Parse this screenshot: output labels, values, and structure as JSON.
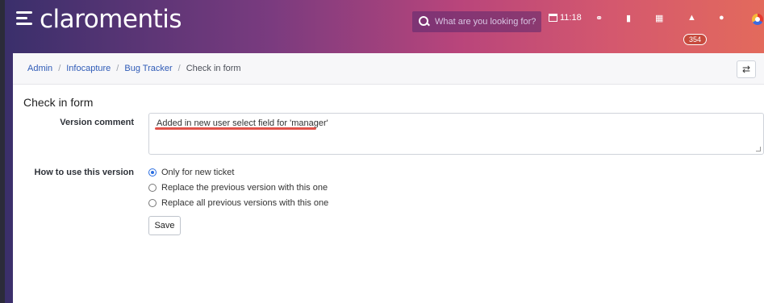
{
  "app": {
    "logo_text": "claromentis"
  },
  "topbar": {
    "search_placeholder": "What are you looking for?",
    "time": "11:18",
    "notification_count": "354"
  },
  "breadcrumb": [
    {
      "label": "Admin"
    },
    {
      "label": "Infocapture"
    },
    {
      "label": "Bug Tracker"
    },
    {
      "label": "Check in form"
    }
  ],
  "form": {
    "title": "Check in form",
    "version_comment_label": "Version comment",
    "version_comment_value": "Added in new user select field for 'manager'",
    "how_to_use_label": "How to use this version",
    "options": [
      {
        "label": "Only for new ticket",
        "checked": true
      },
      {
        "label": "Replace the previous version with this one",
        "checked": false
      },
      {
        "label": "Replace all previous versions with this one",
        "checked": false
      }
    ],
    "save_label": "Save"
  },
  "colors": {
    "accent": "#2f5bb7",
    "highlight_underline": "#e0524a",
    "badge": "#c74a3d"
  }
}
